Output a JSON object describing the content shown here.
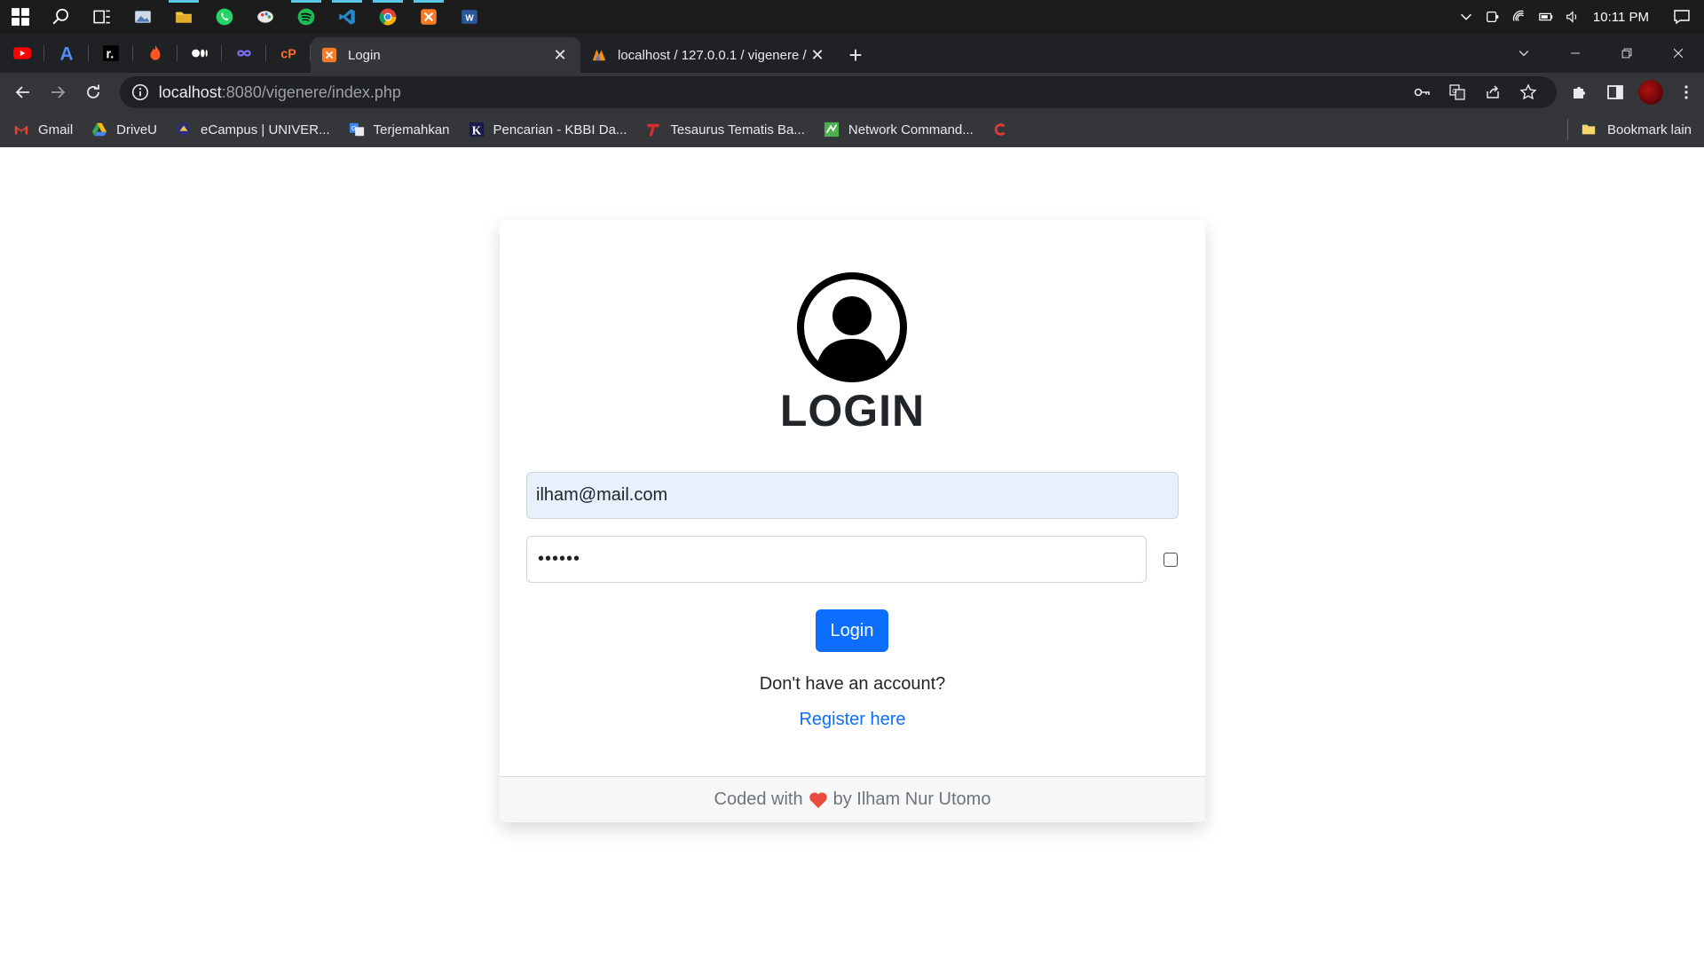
{
  "taskbar": {
    "clock": "10:11 PM",
    "apps": [
      "windows-start-icon",
      "search-icon",
      "task-view-icon",
      "photos-icon",
      "file-explorer-icon",
      "whatsapp-icon",
      "paint-icon",
      "spotify-icon",
      "vscode-icon",
      "chrome-icon",
      "xampp-icon",
      "word-icon"
    ]
  },
  "browser": {
    "tabs": [
      {
        "title": "Login",
        "active": true
      },
      {
        "title": "localhost / 127.0.0.1 / vigenere /",
        "active": false
      }
    ],
    "url_host": "localhost",
    "url_rest": ":8080/vigenere/index.php",
    "bookmarks": [
      {
        "label": "Gmail",
        "icon": "gmail-icon"
      },
      {
        "label": "DriveU",
        "icon": "drive-icon"
      },
      {
        "label": "eCampus | UNIVER...",
        "icon": "ecampus-icon"
      },
      {
        "label": "Terjemahkan",
        "icon": "translate-icon"
      },
      {
        "label": "Pencarian - KBBI Da...",
        "icon": "kbbi-icon"
      },
      {
        "label": "Tesaurus Tematis Ba...",
        "icon": "tesaurus-icon"
      },
      {
        "label": "Network Command...",
        "icon": "network-icon"
      }
    ],
    "other_bookmarks": "Bookmark lain"
  },
  "login": {
    "title": "LOGIN",
    "email_value": "ilham@mail.com",
    "password_value": "••••••",
    "button": "Login",
    "no_account": "Don't have an account?",
    "register": "Register here",
    "footer_prefix": "Coded with",
    "footer_suffix": "by Ilham Nur Utomo"
  },
  "colors": {
    "primary": "#0d6efd",
    "autofill": "#e8f0fe",
    "heart": "#e74c3c"
  }
}
